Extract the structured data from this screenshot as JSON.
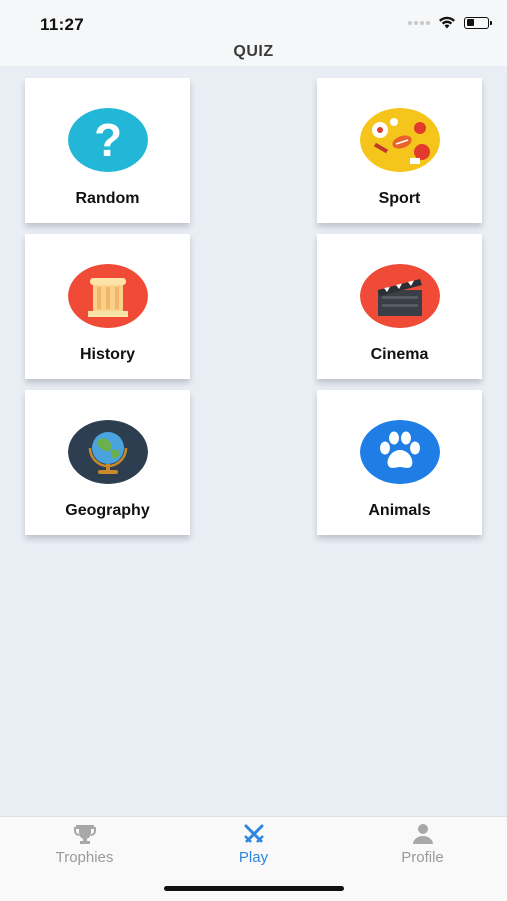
{
  "status_bar": {
    "time": "11:27"
  },
  "nav": {
    "title": "QUIZ"
  },
  "categories": [
    {
      "label": "Random",
      "icon": "question-mark-icon",
      "color": "#23b7d7"
    },
    {
      "label": "Sport",
      "icon": "sports-balls-icon",
      "color": "#f6c51b"
    },
    {
      "label": "History",
      "icon": "column-icon",
      "color": "#f04b37"
    },
    {
      "label": "Cinema",
      "icon": "clapperboard-icon",
      "color": "#f04b37"
    },
    {
      "label": "Geography",
      "icon": "globe-icon",
      "color": "#2c3e50"
    },
    {
      "label": "Animals",
      "icon": "paw-icon",
      "color": "#1f7ee6"
    }
  ],
  "tabs": [
    {
      "label": "Trophies",
      "icon": "trophy-icon",
      "active": false
    },
    {
      "label": "Play",
      "icon": "crossed-swords-icon",
      "active": true
    },
    {
      "label": "Profile",
      "icon": "person-icon",
      "active": false
    }
  ],
  "colors": {
    "accent": "#2e86de",
    "inactive": "#9a9a9a",
    "background": "#e9eef5"
  }
}
